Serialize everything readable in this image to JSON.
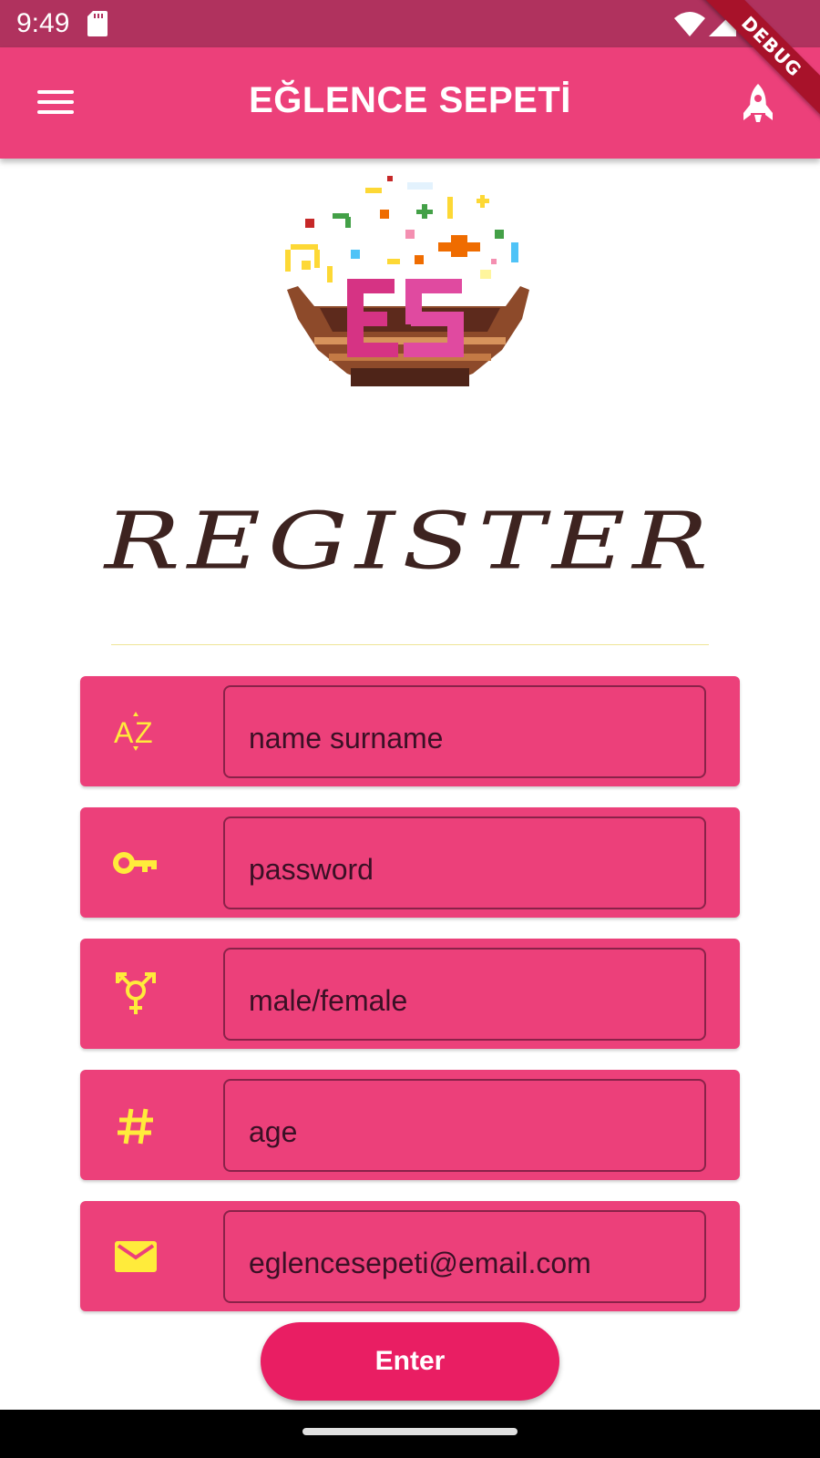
{
  "status_bar": {
    "time": "9:49"
  },
  "debug_banner": "DEBUG",
  "app_bar": {
    "title": "EĞLENCE SEPETİ"
  },
  "page": {
    "heading": "REGISTER"
  },
  "form": {
    "fields": [
      {
        "icon": "sort-by-alpha-icon",
        "placeholder": "name surname",
        "value": ""
      },
      {
        "icon": "key-icon",
        "placeholder": "password",
        "value": ""
      },
      {
        "icon": "transgender-icon",
        "placeholder": "male/female",
        "value": ""
      },
      {
        "icon": "hash-icon",
        "placeholder": "age",
        "value": ""
      },
      {
        "icon": "email-icon",
        "placeholder": "eglencesepeti@email.com",
        "value": ""
      }
    ],
    "submit_label": "Enter"
  },
  "colors": {
    "app_bar": "#ec407a",
    "status_bar": "#b0325e",
    "card": "#ec407a",
    "icon": "#ffeb3b",
    "button": "#e91e63",
    "heading": "#3d2320"
  }
}
